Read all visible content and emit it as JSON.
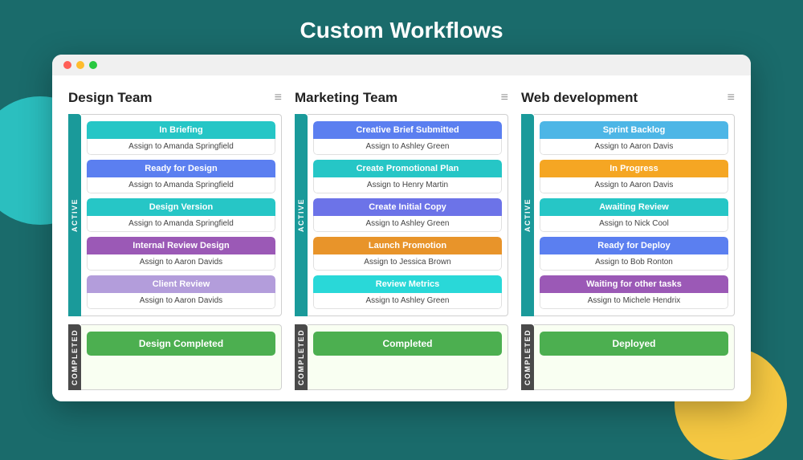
{
  "page": {
    "title": "Custom Workflows",
    "bg_circle_teal": "teal-circle",
    "bg_circle_yellow": "yellow-circle"
  },
  "browser": {
    "dots": [
      "red",
      "yellow",
      "green"
    ]
  },
  "columns": [
    {
      "id": "design-team",
      "title": "Design Team",
      "menu_icon": "≡",
      "active_label": "ACTIVE",
      "completed_label": "COMPLETED",
      "tasks": [
        {
          "label": "In Briefing",
          "assignee": "Assign to Amanda Springfield",
          "color": "color-teal"
        },
        {
          "label": "Ready for Design",
          "assignee": "Assign to Amanda Springfield",
          "color": "color-blue"
        },
        {
          "label": "Design Version",
          "assignee": "Assign to Amanda Springfield",
          "color": "color-teal"
        },
        {
          "label": "Internal Review Design",
          "assignee": "Assign to Aaron Davids",
          "color": "color-purple"
        },
        {
          "label": "Client Review",
          "assignee": "Assign to Aaron Davids",
          "color": "color-lavender"
        }
      ],
      "completed_btn": "Design Completed"
    },
    {
      "id": "marketing-team",
      "title": "Marketing Team",
      "menu_icon": "≡",
      "active_label": "ACTIVE",
      "completed_label": "COMPLETED",
      "tasks": [
        {
          "label": "Creative Brief Submitted",
          "assignee": "Assign to Ashley Green",
          "color": "color-blue"
        },
        {
          "label": "Create Promotional Plan",
          "assignee": "Assign to Henry Martin",
          "color": "color-teal"
        },
        {
          "label": "Create Initial Copy",
          "assignee": "Assign to Ashley Green",
          "color": "color-indigo"
        },
        {
          "label": "Launch Promotion",
          "assignee": "Assign to Jessica Brown",
          "color": "color-amber"
        },
        {
          "label": "Review Metrics",
          "assignee": "Assign to Ashley Green",
          "color": "color-cyan"
        }
      ],
      "completed_btn": "Completed"
    },
    {
      "id": "web-development",
      "title": "Web development",
      "menu_icon": "≡",
      "active_label": "ACTIVE",
      "completed_label": "COMPLETED",
      "tasks": [
        {
          "label": "Sprint Backlog",
          "assignee": "Assign to Aaron Davis",
          "color": "color-light-blue"
        },
        {
          "label": "In Progress",
          "assignee": "Assign to Aaron Davis",
          "color": "color-orange"
        },
        {
          "label": "Awaiting Review",
          "assignee": "Assign to Nick Cool",
          "color": "color-teal"
        },
        {
          "label": "Ready for Deploy",
          "assignee": "Assign to Bob Ronton",
          "color": "color-blue"
        },
        {
          "label": "Waiting for other tasks",
          "assignee": "Assign to Michele Hendrix",
          "color": "color-purple"
        }
      ],
      "completed_btn": "Deployed"
    }
  ]
}
